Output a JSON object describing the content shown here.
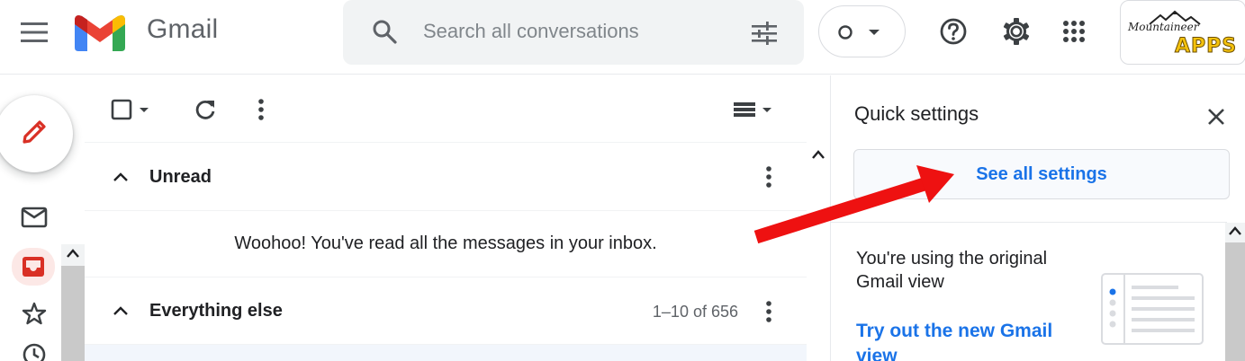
{
  "header": {
    "app_name": "Gmail",
    "search_placeholder": "Search all conversations",
    "account_brand_top": "Mountaineer",
    "account_brand_bottom": "APPS"
  },
  "toolbar": {},
  "sections": [
    {
      "title": "Unread",
      "empty_message": "Woohoo! You've read all the messages in your inbox."
    },
    {
      "title": "Everything else",
      "count": "1–10 of 656"
    }
  ],
  "quick_settings": {
    "title": "Quick settings",
    "see_all_label": "See all settings",
    "view_text": "You're using the original Gmail view",
    "try_link": "Try out the new Gmail view"
  },
  "icons": [
    "menu-icon",
    "gmail-logo",
    "search-icon",
    "search-options-icon",
    "status-icon",
    "help-icon",
    "settings-icon",
    "apps-icon",
    "compose-pencil-icon",
    "mail-icon",
    "inbox-icon",
    "star-icon",
    "clock-icon",
    "checkbox-icon",
    "refresh-icon",
    "more-vert-icon",
    "density-icon",
    "close-icon"
  ],
  "colors": {
    "accent": "#1a73e8",
    "annotation_arrow": "#ee1111",
    "compose_pencil": "#d93025",
    "active_inbox": "#d93025"
  }
}
